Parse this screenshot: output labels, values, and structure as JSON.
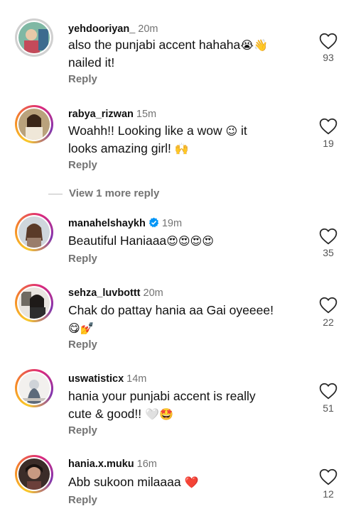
{
  "comments": [
    {
      "username": "yehdooriyan_",
      "time": "20m",
      "line1": "also the punjabi accent hahaha",
      "emoji1": "😭👋",
      "line2": "nailed it!",
      "emoji2": "",
      "reply": "Reply",
      "likes": "93",
      "verified": false
    },
    {
      "username": "rabya_rizwan",
      "time": "15m",
      "line1": "Woahh!! Looking like a wow",
      "emoji1": "😉",
      "line1b": " it",
      "line2": "looks amazing girl!",
      "emoji2": "🙌",
      "reply": "Reply",
      "likes": "19",
      "verified": false
    },
    {
      "username": "manahelshaykh",
      "time": "19m",
      "line1": "Beautiful Haniaaa",
      "emoji1": "😍😍😍😍",
      "reply": "Reply",
      "likes": "35",
      "verified": true
    },
    {
      "username": "sehza_luvbottt",
      "time": "20m",
      "line1": "Chak do pattay hania aa Gai oyeeee!",
      "emoji1": "",
      "line2": "",
      "emoji2": "😋💅",
      "reply": "Reply",
      "likes": "22",
      "verified": false
    },
    {
      "username": "uswatisticx",
      "time": "14m",
      "line1": "hania your punjabi accent is really",
      "emoji1": "",
      "line2": "cute & good!!",
      "emoji2": "🤍🤩",
      "reply": "Reply",
      "likes": "51",
      "verified": false
    },
    {
      "username": "hania.x.muku",
      "time": "16m",
      "line1": "Abb sukoon milaaaa",
      "emoji1": "❤️",
      "reply": "Reply",
      "likes": "12",
      "verified": false
    }
  ],
  "view_more": "View 1 more reply",
  "colors": {
    "text": "#111111",
    "muted": "#737373",
    "verified": "#0095f6",
    "heart_outline": "#262626"
  },
  "icons": {
    "like": "heart-outline-icon",
    "verified": "verified-badge-icon"
  }
}
